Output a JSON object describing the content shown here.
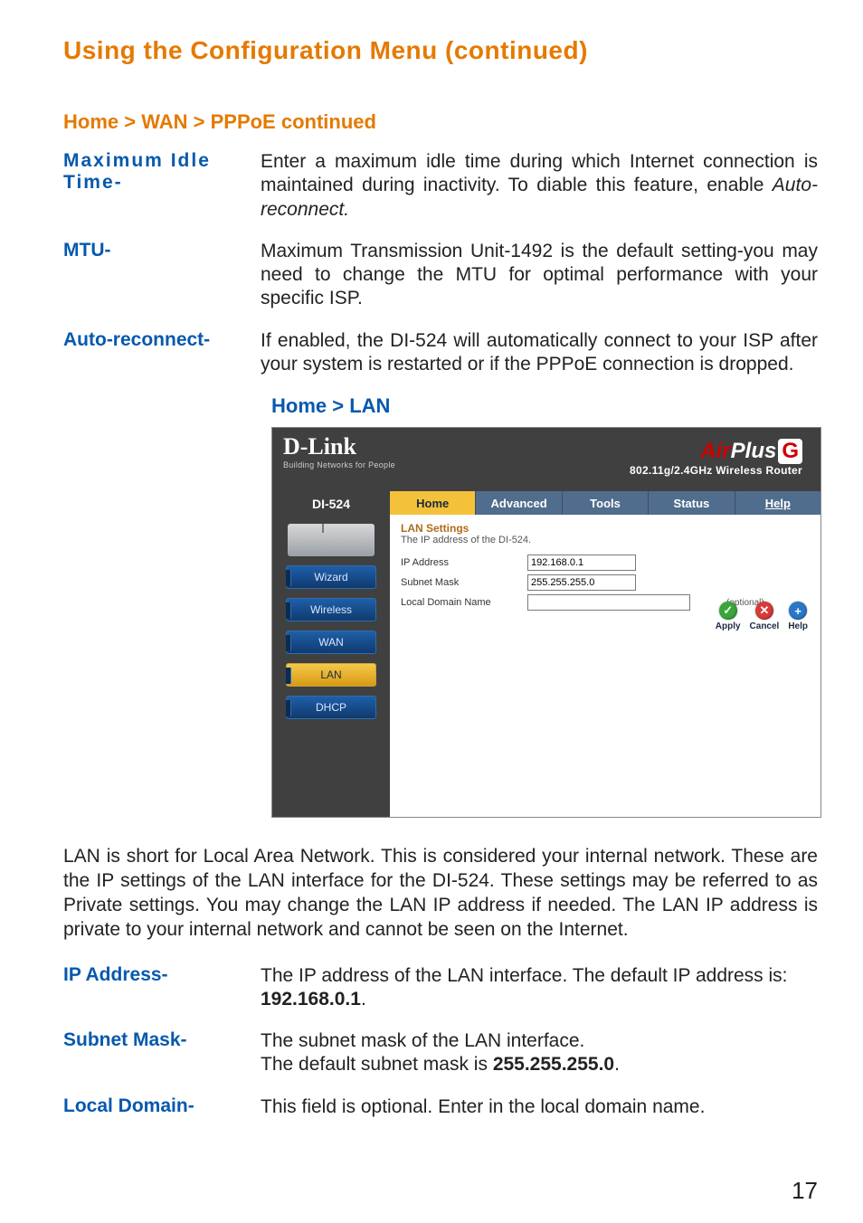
{
  "page": {
    "title": "Using the Configuration Menu (continued)",
    "number": "17"
  },
  "breadcrumb1": "Home > WAN > PPPoE continued",
  "defs1": [
    {
      "term": "Maximum Idle Time-",
      "body_pre": "Enter a maximum idle time during which Internet connection is maintained during inactivity. To diable this feature, enable ",
      "body_em": "Auto-reconnect.",
      "body_post": ""
    },
    {
      "term": "MTU-",
      "body_pre": "Maximum Transmission Unit-1492 is the default setting-you may need to change the MTU for optimal performance with your specific ISP.",
      "body_em": "",
      "body_post": ""
    },
    {
      "term": "Auto-reconnect-",
      "body_pre": "If enabled, the DI-524 will automatically connect to your ISP after your system is restarted or if the PPPoE connection is dropped.",
      "body_em": "",
      "body_post": ""
    }
  ],
  "section2": "Home > LAN",
  "router": {
    "logo": "D-Link",
    "logo_tag": "Building Networks for People",
    "brand_air": "Air",
    "brand_plus": "Plus",
    "brand_g": "G",
    "brand_sub": "802.11g/2.4GHz Wireless Router",
    "model": "DI-524",
    "side": [
      "Wizard",
      "Wireless",
      "WAN",
      "LAN",
      "DHCP"
    ],
    "side_active_index": 3,
    "tabs": [
      "Home",
      "Advanced",
      "Tools",
      "Status",
      "Help"
    ],
    "tab_active_index": 0,
    "panel_title": "LAN Settings",
    "panel_sub": "The IP address of the DI-524.",
    "fields": {
      "ip_label": "IP Address",
      "ip_value": "192.168.0.1",
      "mask_label": "Subnet Mask",
      "mask_value": "255.255.255.0",
      "domain_label": "Local Domain Name",
      "domain_value": "",
      "optional": "(optional)"
    },
    "actions": {
      "apply": "Apply",
      "cancel": "Cancel",
      "help": "Help"
    }
  },
  "para_lan": "LAN is short for Local Area Network. This is considered your internal network. These are the IP settings of the LAN interface for the DI-524. These settings may be referred to as Private settings. You may change the LAN IP address if needed. The LAN IP address is private to your internal network and cannot be seen on the Internet.",
  "defs2": {
    "ip": {
      "term": "IP Address-",
      "line1": "The IP address of the LAN interface. The default IP address is:",
      "bold": "192.168.0.1",
      "after": "."
    },
    "mask": {
      "term": "Subnet Mask-",
      "line1": "The subnet mask of the LAN interface.",
      "line2_pre": "The default subnet mask is ",
      "line2_bold": "255.255.255.0",
      "line2_after": "."
    },
    "domain": {
      "term": "Local Domain-",
      "body": "This field is optional. Enter in the local domain name."
    }
  }
}
